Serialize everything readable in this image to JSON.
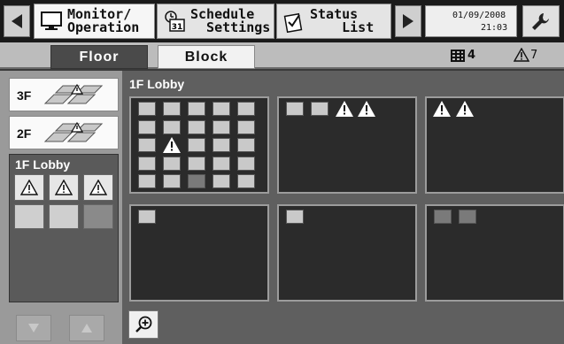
{
  "nav": {
    "tabs": [
      {
        "label_line1": "Monitor/",
        "label_line2": "Operation",
        "icon": "monitor-icon"
      },
      {
        "label_line1": "Schedule",
        "label_line2": "  Settings",
        "icon": "calendar-icon"
      },
      {
        "label_line1": "Status",
        "label_line2": "    List",
        "icon": "status-list-icon"
      }
    ],
    "date": "01/09/2008",
    "time": "21:03",
    "tool_icon": "wrench-icon"
  },
  "subtabs": {
    "floor": "Floor",
    "block": "Block",
    "group_count": "4",
    "alarm_count": "7"
  },
  "floors": [
    {
      "label": "3F"
    },
    {
      "label": "2F"
    }
  ],
  "selected_floor": {
    "label": "1F Lobby"
  },
  "main": {
    "title": "1F Lobby",
    "zoom_icon": "zoom-in-icon"
  },
  "colors": {
    "active_tab": "#4a4a4a",
    "block_bg": "#2b2b2b",
    "unit_normal": "#c9c9c9",
    "unit_off": "#7a7a7a"
  }
}
